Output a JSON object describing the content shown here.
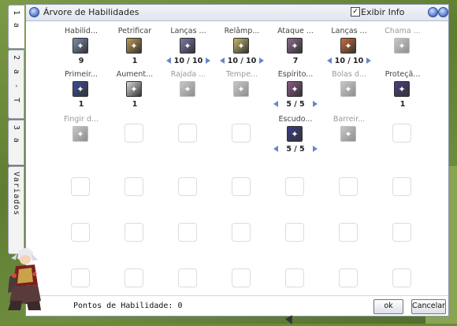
{
  "window": {
    "title": "Árvore de Habilidades",
    "show_info_label": "Exibir Info",
    "show_info_checked": true
  },
  "tabs": [
    "1 a",
    "2 a - T",
    "3 a",
    "Variados"
  ],
  "grid": {
    "rows": [
      [
        {
          "name": "Habilid...",
          "icon": "chat-bubble-icon",
          "level": "9",
          "color": "#7d8fae",
          "arrows": false
        },
        {
          "name": "Petrificar",
          "icon": "statue-icon",
          "level": "1",
          "color": "#c39a52",
          "arrows": false
        },
        {
          "name": "Lanças ...",
          "icon": "ice-spear-icon",
          "level": "10 / 10",
          "color": "#7b79a8",
          "arrows": true
        },
        {
          "name": "Relâmp...",
          "icon": "lightning-icon",
          "level": "10 / 10",
          "color": "#c5b86a",
          "arrows": true
        },
        {
          "name": "Ataque ...",
          "icon": "attack-icon",
          "level": "7",
          "color": "#8a6b8c",
          "arrows": false
        },
        {
          "name": "Lanças ...",
          "icon": "fire-spear-icon",
          "level": "10 / 10",
          "color": "#d06b36",
          "arrows": true
        },
        {
          "name": "Chama ...",
          "icon": "flame-icon",
          "level": "",
          "color": "#9a9a9a",
          "arrows": false,
          "dim": true
        }
      ],
      [
        {
          "name": "Primeir...",
          "icon": "hand-icon",
          "level": "1",
          "color": "#3b4f9a",
          "arrows": false
        },
        {
          "name": "Aument...",
          "icon": "spirit-icon",
          "level": "1",
          "color": "#d8d8d8",
          "arrows": false
        },
        {
          "name": "Rajada ...",
          "icon": "gust-icon",
          "level": "",
          "color": "#9a9a9a",
          "arrows": false,
          "dim": true
        },
        {
          "name": "Tempe...",
          "icon": "storm-icon",
          "level": "",
          "color": "#9a9a9a",
          "arrows": false,
          "dim": true
        },
        {
          "name": "Espírito...",
          "icon": "soul-icon",
          "level": "5 / 5",
          "color": "#8a5a86",
          "arrows": true
        },
        {
          "name": "Bolas d...",
          "icon": "fireball-icon",
          "level": "",
          "color": "#9a9a9a",
          "arrows": false,
          "dim": true
        },
        {
          "name": "Proteçã...",
          "icon": "protection-icon",
          "level": "1",
          "color": "#4a3f86",
          "arrows": false
        }
      ],
      [
        {
          "name": "Fingir d...",
          "icon": "feign-icon",
          "level": "",
          "color": "#9a9a9a",
          "arrows": false,
          "dim": true
        },
        null,
        null,
        null,
        {
          "name": "Escudo...",
          "icon": "shield-icon",
          "level": "5 / 5",
          "color": "#3b3b8a",
          "arrows": true
        },
        {
          "name": "Barreir...",
          "icon": "barrier-icon",
          "level": "",
          "color": "#9a9a9a",
          "arrows": false,
          "dim": true
        },
        null
      ],
      [
        null,
        null,
        null,
        null,
        null,
        null,
        null
      ],
      [
        null,
        null,
        null,
        null,
        null,
        null,
        null
      ],
      [
        null,
        null,
        null,
        null,
        null,
        null,
        null
      ]
    ]
  },
  "footer": {
    "points_label": "Pontos de Habilidade: 0",
    "ok_label": "ok",
    "cancel_label": "Cancelar"
  }
}
